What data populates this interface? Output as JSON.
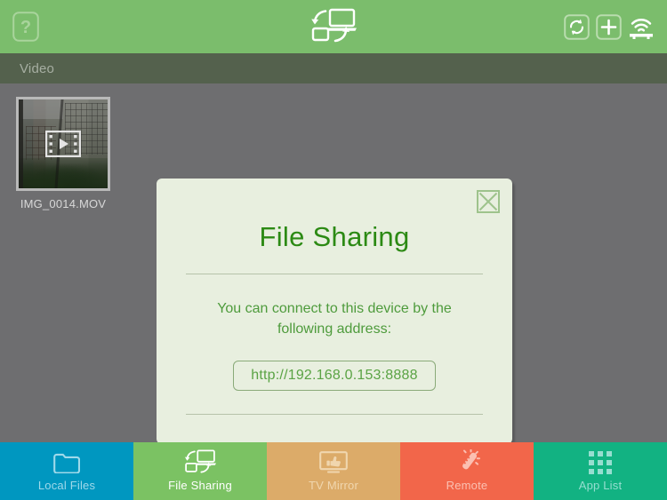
{
  "header": {
    "help_icon": "question-mark-icon",
    "logo_icon": "device-sync-icon",
    "actions": [
      {
        "name": "refresh",
        "icon": "refresh-icon",
        "label": "Refresh"
      },
      {
        "name": "add",
        "icon": "plus-icon",
        "label": "Add"
      },
      {
        "name": "wifi",
        "icon": "wifi-icon",
        "label": "Wi-Fi"
      }
    ]
  },
  "subheader": {
    "label": "Video"
  },
  "files": [
    {
      "name": "IMG_0014.MOV",
      "type": "video",
      "badge_icon": "play-icon"
    }
  ],
  "dialog": {
    "title": "File Sharing",
    "close_icon": "close-icon",
    "message": "You can connect to this device by the following address:",
    "address": "http://192.168.0.153:8888"
  },
  "tabbar": {
    "items": [
      {
        "label": "Local Files",
        "icon": "folder-icon",
        "color": "#0097c0",
        "text_color": "#9fd9ea",
        "active": false
      },
      {
        "label": "File Sharing",
        "icon": "device-sync-icon",
        "color": "#7bc263",
        "text_color": "#ffffff",
        "active": true
      },
      {
        "label": "TV Mirror",
        "icon": "tv-thumbsup-icon",
        "color": "#dcab69",
        "text_color": "#f0d6ae",
        "active": false
      },
      {
        "label": "Remote",
        "icon": "magic-wand-icon",
        "color": "#f2664a",
        "text_color": "#fbc0b2",
        "active": false
      },
      {
        "label": "App List",
        "icon": "grid-dots-icon",
        "color": "#12b282",
        "text_color": "#96ded0",
        "active": false
      }
    ]
  },
  "colors": {
    "header_green": "#7bbd6c",
    "subheader_green": "#54614d",
    "background_gray": "#6e6e70",
    "dialog_bg": "#e8efdf",
    "title_green": "#2c8a14",
    "body_green": "#4e9b3c"
  }
}
